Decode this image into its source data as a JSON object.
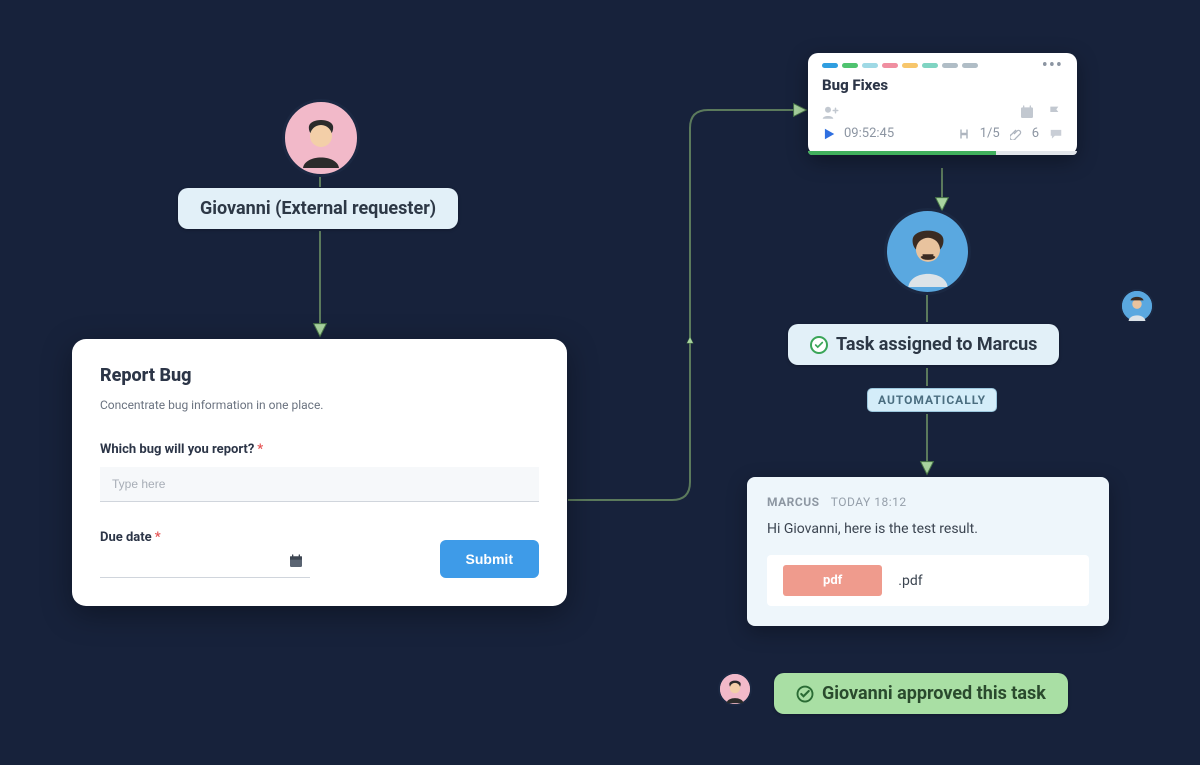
{
  "users": {
    "requester_name": "Giovanni",
    "assignee_name": "Marcus"
  },
  "requester_pill": "Giovanni (External requester)",
  "form": {
    "title": "Report Bug",
    "subtitle": "Concentrate bug information in one place.",
    "q1_label": "Which bug will you report?",
    "q1_placeholder": "Type here",
    "q2_label": "Due date",
    "submit": "Submit"
  },
  "task": {
    "name": "Bug Fixes",
    "timer": "09:52:45",
    "subtasks": "1/5",
    "attachments": "6",
    "segment_colors": [
      "#2f9ee0",
      "#4fc36f",
      "#9fd9e5",
      "#f08ea0",
      "#f7c66b",
      "#7fd4c2",
      "#b0bdc6",
      "#b0bdc6"
    ]
  },
  "assigned_pill": "Task assigned to Marcus",
  "auto_tag": "AUTOMATICALLY",
  "message": {
    "author": "MARCUS",
    "time": "TODAY 18:12",
    "body": "Hi Giovanni, here is the test result.",
    "chip": "pdf",
    "ext": ".pdf"
  },
  "approval_pill": "Giovanni approved this task"
}
